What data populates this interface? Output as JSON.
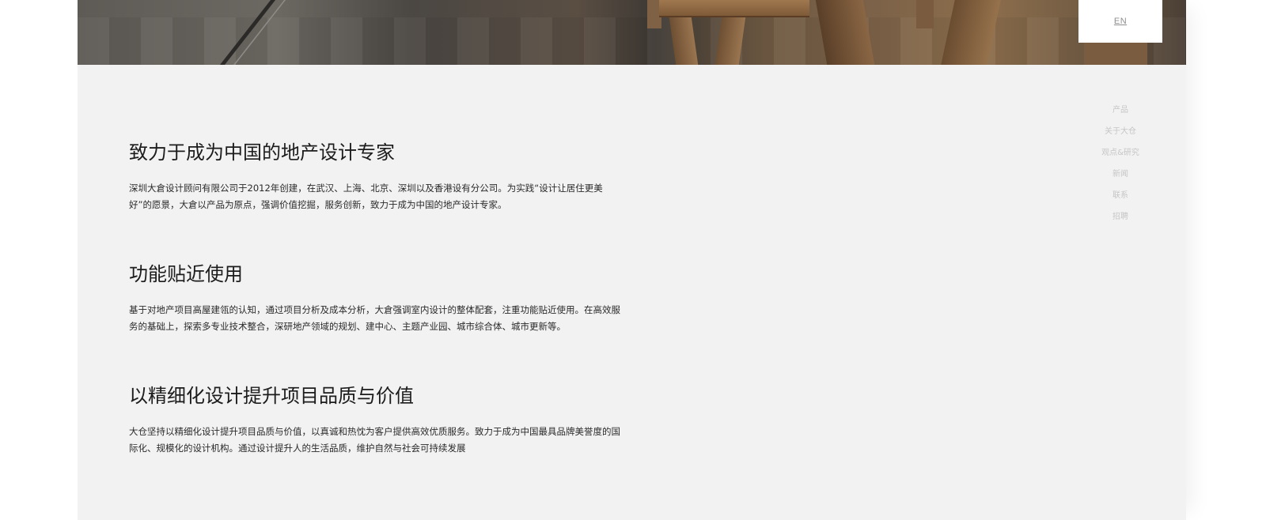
{
  "lang_switch": {
    "label": "EN"
  },
  "nav": {
    "items": [
      {
        "label": "产品"
      },
      {
        "label": "关于大仓"
      },
      {
        "label": "观点&研究"
      },
      {
        "label": "新闻"
      },
      {
        "label": "联系"
      },
      {
        "label": "招聘"
      }
    ]
  },
  "sections": [
    {
      "title": "致力于成为中国的地产设计专家",
      "body": "深圳大倉设计顾问有限公司于2012年创建，在武汉、上海、北京、深圳以及香港设有分公司。为实践“设计让居住更美好”的愿景，大倉以产品为原点，强调价值挖掘，服务创新，致力于成为中国的地产设计专家。"
    },
    {
      "title": "功能贴近使用",
      "body": "基于对地产项目高屋建瓴的认知，通过项目分析及成本分析，大倉强调室内设计的整体配套，注重功能贴近使用。在高效服务的基础上，探索多专业技术整合，深研地产领域的规划、建中心、主题产业园、城市综合体、城市更新等。"
    },
    {
      "title": "以精细化设计提升项目品质与价值",
      "body": "大仓坚持以精细化设计提升项目品质与价值，以真诚和热忱为客户提供高效优质服务。致力于成为中国最具品牌美誉度的国际化、规模化的设计机构。通过设计提升人的生活品质，维护自然与社会可持续发展"
    }
  ]
}
